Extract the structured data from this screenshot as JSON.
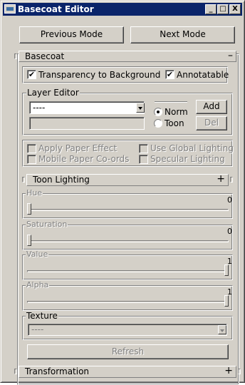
{
  "window": {
    "title": "Basecoat Editor",
    "controls": {
      "minimize": "_",
      "maximize": "□",
      "close": "X"
    }
  },
  "mode_buttons": {
    "previous": "Previous Mode",
    "next": "Next Mode"
  },
  "basecoat_rollup": {
    "title": "Basecoat",
    "toggle": "–",
    "transparency": {
      "label": "Transparency to Background",
      "checked": true
    },
    "annotatable": {
      "label": "Annotatable",
      "checked": true
    },
    "layer_editor": {
      "label": "Layer Editor",
      "layer_select_value": "----",
      "name_field_value": "",
      "radio_norm": "Norm",
      "radio_toon": "Toon",
      "selected_radio": "Norm",
      "add_button": "Add",
      "del_button": "Del"
    },
    "options": {
      "apply_paper_effect": "Apply Paper Effect",
      "mobile_paper_coords": "Mobile Paper Co-ords",
      "use_global_lighting": "Use Global Lighting",
      "specular_lighting": "Specular Lighting"
    }
  },
  "toon_lighting_rollup": {
    "title": "Toon Lighting",
    "toggle": "+"
  },
  "sliders": {
    "hue": {
      "label": "Hue",
      "value": "0",
      "level": 0
    },
    "saturation": {
      "label": "Saturation",
      "value": "0",
      "level": 0
    },
    "value": {
      "label": "Value",
      "value": "1",
      "level": 1
    },
    "alpha": {
      "label": "Alpha",
      "value": "1",
      "level": 1
    }
  },
  "texture": {
    "label": "Texture",
    "select_value": "----"
  },
  "refresh_button": "Refresh",
  "transformation_rollup": {
    "title": "Transformation",
    "toggle": "+"
  }
}
